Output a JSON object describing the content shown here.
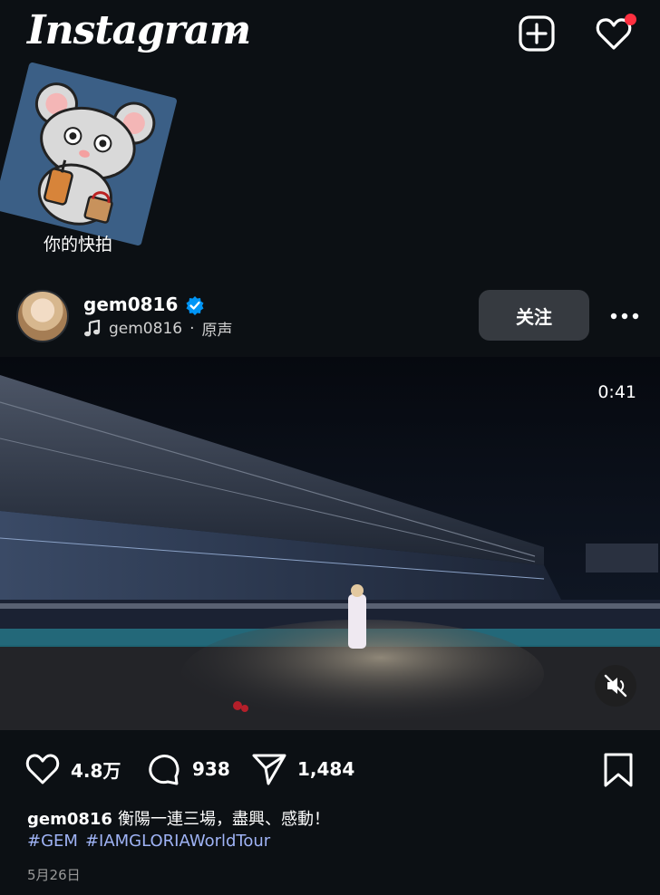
{
  "header": {
    "logo": "Instagram",
    "icons": [
      "chevron-down-icon",
      "new-post-icon",
      "heart-icon"
    ],
    "notification_color": "#ff3040"
  },
  "sticker": {
    "caption": "你的快拍"
  },
  "post": {
    "username": "gem0816",
    "audio": {
      "artist": "gem0816",
      "separator": "·",
      "title": "原声"
    },
    "follow_label": "关注",
    "video_duration": "0:41",
    "likes": "4.8万",
    "comments": "938",
    "shares": "1,484",
    "caption_user": "gem0816",
    "caption_text": "衡陽一連三場，盡興、感動！",
    "hashtags": [
      "#GEM",
      "#IAMGLORIAWorldTour"
    ],
    "date": "5月26日"
  },
  "colors": {
    "background": "#0c1014",
    "follow_button": "#363a40",
    "hashtag": "#9fb3f5",
    "verified": "#0095f6"
  }
}
